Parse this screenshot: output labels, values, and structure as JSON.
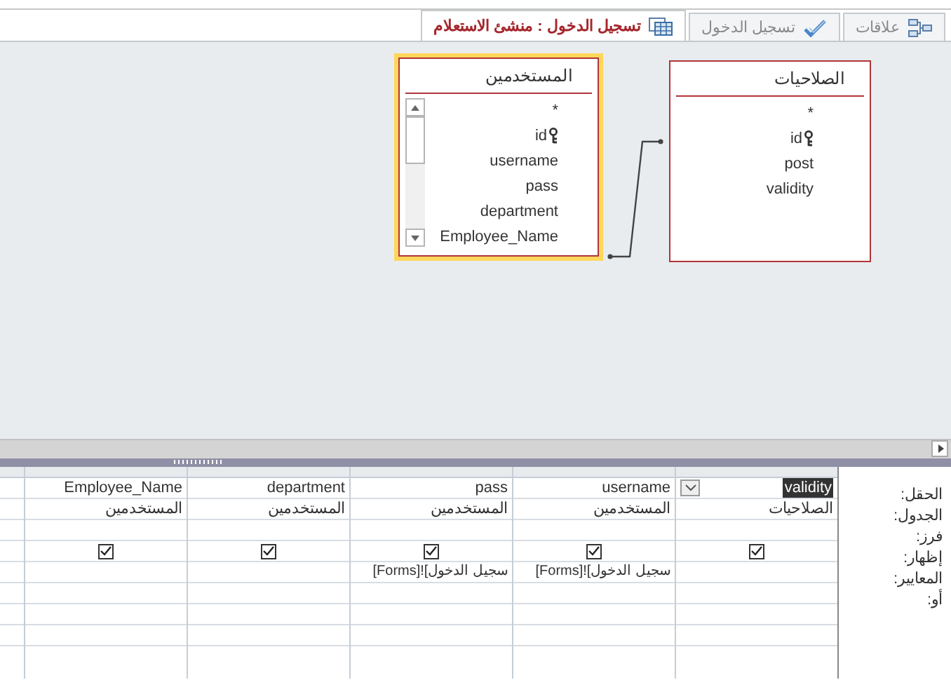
{
  "tabs": [
    {
      "label": "علاقات",
      "selected": false
    },
    {
      "label": "تسجيل الدخول",
      "selected": false
    },
    {
      "label": "تسجيل الدخول : منشئ الاستعلام",
      "selected": true
    }
  ],
  "diagram": {
    "tables": [
      {
        "title": "الصلاحيات",
        "selected": false,
        "fields": [
          {
            "name": "*",
            "key": false
          },
          {
            "name": "id",
            "key": true
          },
          {
            "name": "post",
            "key": false
          },
          {
            "name": "validity",
            "key": false
          }
        ]
      },
      {
        "title": "المستخدمين",
        "selected": true,
        "fields": [
          {
            "name": "*",
            "key": false
          },
          {
            "name": "id",
            "key": true
          },
          {
            "name": "username",
            "key": false
          },
          {
            "name": "pass",
            "key": false
          },
          {
            "name": "department",
            "key": false
          },
          {
            "name": "Employee_Name",
            "key": false
          }
        ]
      }
    ]
  },
  "grid": {
    "row_labels": [
      "الحقل:",
      "الجدول:",
      "فرز:",
      "إظهار:",
      "المعايير:",
      "أو:"
    ],
    "columns": [
      {
        "field": "validity",
        "field_selected": true,
        "table": "الصلاحيات",
        "show": true
      },
      {
        "field": "username",
        "field_selected": false,
        "table": "المستخدمين",
        "show": true,
        "criteria": "[Forms]![سجيل الدخول"
      },
      {
        "field": "pass",
        "field_selected": false,
        "table": "المستخدمين",
        "show": true,
        "criteria": "[Forms]![سجيل الدخول"
      },
      {
        "field": "department",
        "field_selected": false,
        "table": "المستخدمين",
        "show": true
      },
      {
        "field": "Employee_Name",
        "field_selected": false,
        "table": "المستخدمين",
        "show": true
      }
    ]
  }
}
